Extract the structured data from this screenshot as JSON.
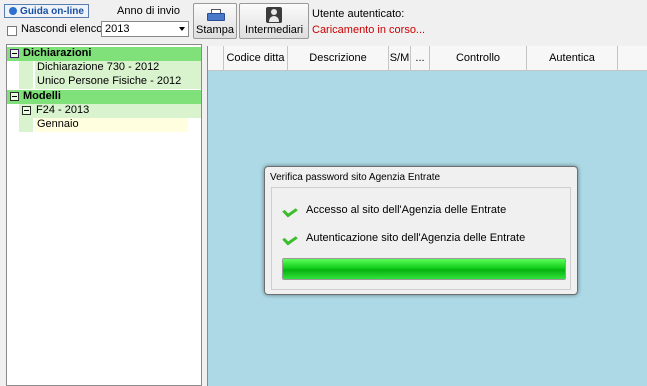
{
  "toolbar": {
    "guida_label": "Guida on-line",
    "nascondi_label": "Nascondi elenco",
    "anno_label": "Anno di invio",
    "anno_value": "2013",
    "stampa_label": "Stampa",
    "intermediari_label": "Intermediari",
    "utente_label": "Utente autenticato:",
    "status_text": "Caricamento in corso..."
  },
  "tree": {
    "group1": "Dichiarazioni",
    "item1": "Dichiarazione 730 - 2012",
    "item2": "Unico Persone Fisiche - 2012",
    "group2": "Modelli",
    "subgroup": "F24 - 2013",
    "leaf": "Gennaio"
  },
  "grid": {
    "columns": [
      "Codice ditta",
      "Descrizione",
      "S/M",
      "...",
      "Controllo",
      "Autentica"
    ]
  },
  "dialog": {
    "title": "Verifica password sito Agenzia Entrate",
    "step1": "Accesso al sito dell'Agenzia delle Entrate",
    "step2": "Autenticazione sito dell'Agenzia delle Entrate",
    "progress": 1.0
  },
  "colors": {
    "grid_background": "#add9e6",
    "tree_group": "#80e07a",
    "status_red": "#cc0000",
    "progress_green": "#12d01a"
  }
}
